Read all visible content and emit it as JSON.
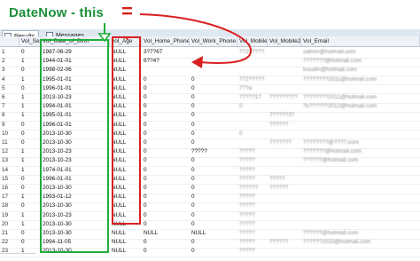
{
  "callout": {
    "text": "DateNow - this",
    "equals": "="
  },
  "tabs": [
    {
      "label": "Results"
    },
    {
      "label": "Messages"
    }
  ],
  "columns": [
    "",
    "Vol_Sex",
    "Vol_Date_of_Birth",
    "vol_Age",
    "Vol_Home_Phone",
    "Vol_Work_Phone",
    "Vol_Mobile1",
    "Vol_Mobile2",
    "Vol_Email"
  ],
  "rows": [
    {
      "n": "1",
      "sex": "0",
      "dob": "1987-06-29",
      "age": "NULL",
      "home": "3?7?67",
      "work": "",
      "m1": "?72?????",
      "m2": "",
      "email": "salmin@hotmail.com"
    },
    {
      "n": "2",
      "sex": "1",
      "dob": "1944-01-01",
      "age": "NULL",
      "home": "6??4?",
      "work": "",
      "m1": "",
      "m2": "",
      "email": "???????@hotmail.com"
    },
    {
      "n": "3",
      "sex": "0",
      "dob": "1998-02-06",
      "age": "NULL",
      "home": "",
      "work": "",
      "m1": "",
      "m2": "",
      "email": "lvsudin@hotmail.com"
    },
    {
      "n": "4",
      "sex": "1",
      "dob": "1995-01-01",
      "age": "NULL",
      "home": "0",
      "work": "0",
      "m1": "?72?????",
      "m2": "",
      "email": "????????2011@hotmail.com"
    },
    {
      "n": "5",
      "sex": "0",
      "dob": "1996-01-01",
      "age": "NULL",
      "home": "0",
      "work": "0",
      "m1": "7??a",
      "m2": "",
      "email": ""
    },
    {
      "n": "6",
      "sex": "1",
      "dob": "2013-10-23",
      "age": "NULL",
      "home": "0",
      "work": "0",
      "m1": "?????1?",
      "m2": "?????????",
      "email": "????????2011@hotmail.com"
    },
    {
      "n": "7",
      "sex": "1",
      "dob": "1994-01-01",
      "age": "NULL",
      "home": "0",
      "work": "0",
      "m1": "0",
      "m2": "",
      "email": "?x??????2012@hotmail.com"
    },
    {
      "n": "8",
      "sex": "1",
      "dob": "1995-01-01",
      "age": "NULL",
      "home": "0",
      "work": "0",
      "m1": "",
      "m2": "7?????3?",
      "email": ""
    },
    {
      "n": "9",
      "sex": "0",
      "dob": "1996-01-01",
      "age": "NULL",
      "home": "0",
      "work": "0",
      "m1": "",
      "m2": "??????",
      "email": ""
    },
    {
      "n": "10",
      "sex": "0",
      "dob": "2013-10-30",
      "age": "NULL",
      "home": "0",
      "work": "0",
      "m1": "0",
      "m2": "",
      "email": ""
    },
    {
      "n": "11",
      "sex": "0",
      "dob": "2013-10-30",
      "age": "NULL",
      "home": "0",
      "work": "0",
      "m1": "",
      "m2": "7??????",
      "email": "????????@????.com"
    },
    {
      "n": "12",
      "sex": "1",
      "dob": "2013-10-23",
      "age": "NULL",
      "home": "0",
      "work": "?????",
      "m1": "?????",
      "m2": "",
      "email": "???????@hotmail.com"
    },
    {
      "n": "13",
      "sex": "1",
      "dob": "2013-10-23",
      "age": "NULL",
      "home": "0",
      "work": "0",
      "m1": "?????",
      "m2": "",
      "email": "??????@hotmail.com"
    },
    {
      "n": "14",
      "sex": "1",
      "dob": "1974-01-01",
      "age": "NULL",
      "home": "0",
      "work": "0",
      "m1": "?????",
      "m2": "",
      "email": ""
    },
    {
      "n": "15",
      "sex": "0",
      "dob": "1996-01-01",
      "age": "NULL",
      "home": "0",
      "work": "0",
      "m1": "?????",
      "m2": "?????",
      "email": ""
    },
    {
      "n": "16",
      "sex": "0",
      "dob": "2013-10-30",
      "age": "NULL",
      "home": "0",
      "work": "0",
      "m1": "??????",
      "m2": "??????",
      "email": ""
    },
    {
      "n": "17",
      "sex": "1",
      "dob": "1993-01-12",
      "age": "NULL",
      "home": "0",
      "work": "0",
      "m1": "?????",
      "m2": "",
      "email": ""
    },
    {
      "n": "18",
      "sex": "0",
      "dob": "2013-10-30",
      "age": "NULL",
      "home": "0",
      "work": "0",
      "m1": "?????",
      "m2": "",
      "email": ""
    },
    {
      "n": "19",
      "sex": "1",
      "dob": "2013-10-23",
      "age": "NULL",
      "home": "0",
      "work": "0",
      "m1": "?????",
      "m2": "",
      "email": ""
    },
    {
      "n": "20",
      "sex": "1",
      "dob": "2013-10-30",
      "age": "NULL",
      "home": "0",
      "work": "0",
      "m1": "?????",
      "m2": "",
      "email": ""
    },
    {
      "n": "21",
      "sex": "0",
      "dob": "2013-10-30",
      "age": "NULL",
      "home": "NULL",
      "work": "NULL",
      "m1": "?????",
      "m2": "",
      "email": "??????@hotmail.com"
    },
    {
      "n": "22",
      "sex": "0",
      "dob": "1994-11-05",
      "age": "NULL",
      "home": "0",
      "work": "0",
      "m1": "?????",
      "m2": "??????",
      "email": "??????2010@hotmail.com"
    },
    {
      "n": "23",
      "sex": "1",
      "dob": "2013-10-30",
      "age": "NULL",
      "home": "0",
      "work": "0",
      "m1": "?????",
      "m2": "",
      "email": ""
    }
  ],
  "colors": {
    "green": "#1fae3c",
    "red": "#d92020",
    "header_bg": "#eef1f6"
  }
}
